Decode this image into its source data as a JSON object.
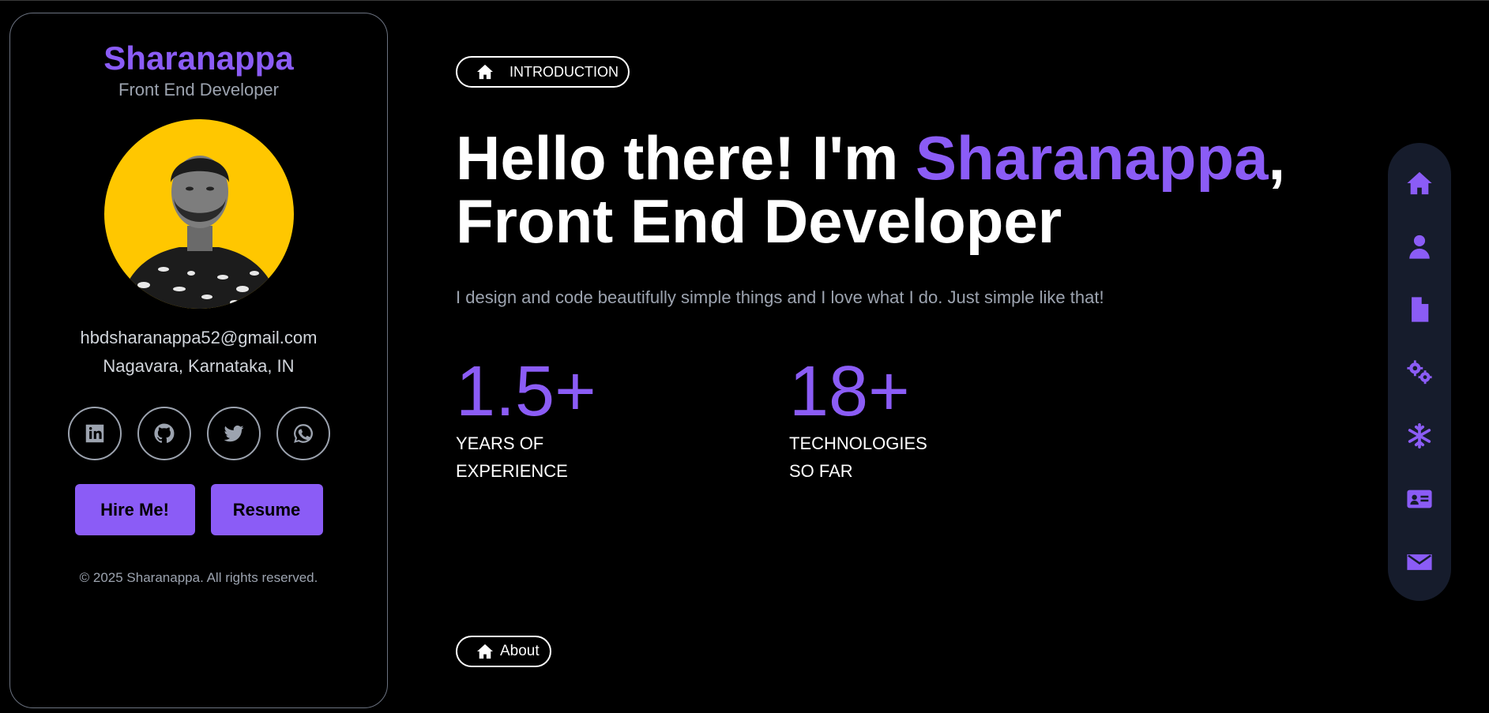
{
  "profile": {
    "name": "Sharanappa",
    "role": "Front End Developer",
    "email": "hbdsharanappa52@gmail.com",
    "location": "Nagavara, Karnataka, IN",
    "socials": [
      "linkedin-icon",
      "github-icon",
      "twitter-icon",
      "whatsapp-icon"
    ],
    "hire_label": "Hire Me!",
    "resume_label": "Resume",
    "copyright": "© 2025 Sharanappa. All rights reserved."
  },
  "main": {
    "section_pill": "INTRODUCTION",
    "headline_pre": "Hello there! I'm ",
    "headline_name": "Sharanappa",
    "headline_comma": ",",
    "headline_line2": "Front End Developer",
    "tagline": "I design and code beautifully simple things and I love what I do. Just simple like that!",
    "stats": [
      {
        "value": "1.5+",
        "label_line1": "YEARS OF",
        "label_line2": "EXPERIENCE"
      },
      {
        "value": "18+",
        "label_line1": "TECHNOLOGIES",
        "label_line2": "SO FAR"
      }
    ],
    "next_pill": "About"
  },
  "nav": {
    "items": [
      "home-icon",
      "user-icon",
      "document-icon",
      "gears-icon",
      "snowflake-icon",
      "id-card-icon",
      "envelope-icon"
    ]
  },
  "colors": {
    "accent": "#8b5cf6",
    "background": "#000000",
    "card_border": "#6b7280",
    "muted_text": "#9ca3af",
    "avatar_bg": "#ffc700",
    "nav_bg": "#161c2c"
  }
}
